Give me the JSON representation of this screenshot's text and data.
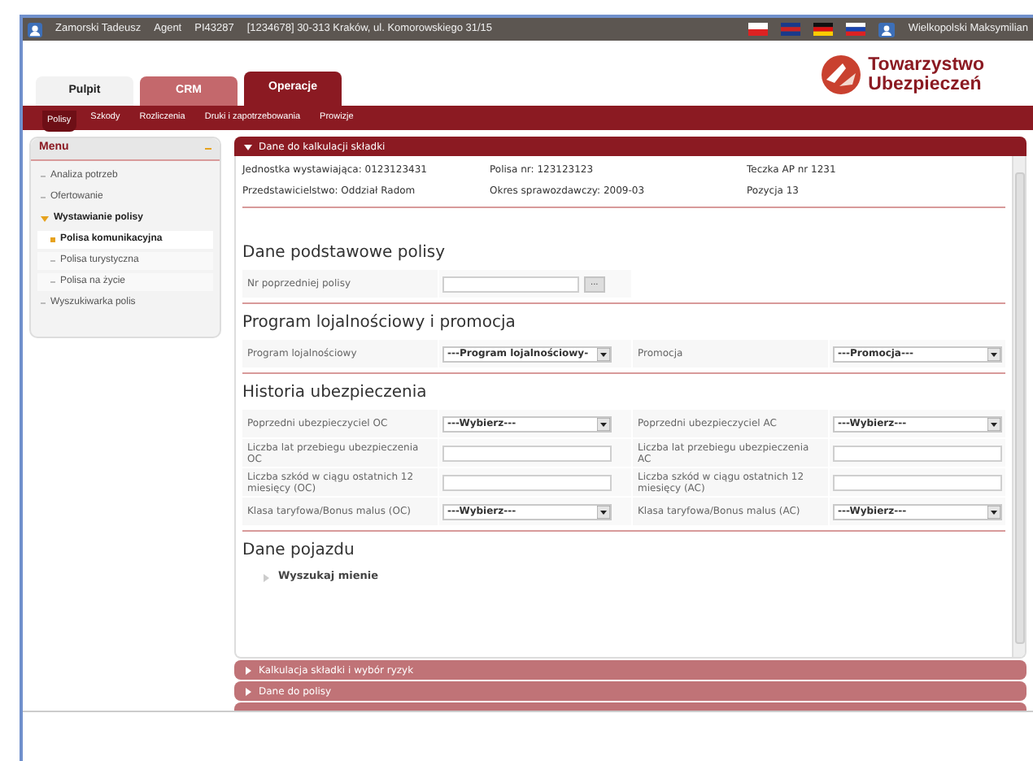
{
  "top_bar": {
    "user": "Zamorski Tadeusz",
    "role": "Agent",
    "agent_id": "PI43287",
    "address": "[1234678] 30-313 Kraków, ul. Komorowskiego 31/15",
    "right_user": "Wielkopolski Maksymilian"
  },
  "logo": {
    "line1": "Towarzystwo",
    "line2": "Ubezpieczeń"
  },
  "tabs": [
    {
      "label": "Pulpit",
      "selected": false,
      "color": "#f2f2f2"
    },
    {
      "label": "CRM",
      "selected": false,
      "color": "#c4686c"
    },
    {
      "label": "Operacje",
      "selected": true,
      "color": "#8b1a22"
    }
  ],
  "subnav": [
    {
      "label": "Polisy",
      "selected": true
    },
    {
      "label": "Szkody",
      "selected": false
    },
    {
      "label": "Rozliczenia",
      "selected": false
    },
    {
      "label": "Druki i zapotrzebowania",
      "selected": false
    },
    {
      "label": "Prowizje",
      "selected": false
    }
  ],
  "menu": {
    "title": "Menu",
    "items": [
      {
        "label": "Analiza potrzeb",
        "expanded": false,
        "selected": false
      },
      {
        "label": "Ofertowanie",
        "expanded": false,
        "selected": false
      },
      {
        "label": "Wystawianie polisy",
        "expanded": true,
        "selected": false,
        "children": [
          {
            "label": "Polisa komunikacyjna",
            "selected": true
          },
          {
            "label": "Polisa turystyczna",
            "selected": false
          },
          {
            "label": "Polisa na życie",
            "selected": false
          }
        ]
      },
      {
        "label": "Wyszukiwarka polis",
        "expanded": false,
        "selected": false
      }
    ]
  },
  "panel": {
    "title": "Dane do kalkulacji składki",
    "expanded": true,
    "info": [
      "Jednostka wystawiająca: 0123123431",
      "Polisa nr: 123123123",
      "Teczka AP nr 1231",
      "Przedstawicielstwo: Oddział Radom",
      "Okres sprawozdawczy: 2009-03",
      "Pozycja 13"
    ],
    "sections": [
      {
        "title": "Dane podstawowe polisy",
        "rows": [
          {
            "cells": [
              {
                "label": "Nr poprzedniej polisy",
                "kind": "lookup",
                "button": "..."
              }
            ]
          }
        ]
      },
      {
        "title": "Program lojalnościowy i promocja",
        "rows": [
          {
            "cells": [
              {
                "label": "Program lojalnościowy",
                "kind": "select",
                "value": "---Program lojalnościowy-"
              },
              {
                "label": "Promocja",
                "kind": "select",
                "value": "---Promocja---"
              }
            ]
          }
        ]
      },
      {
        "title": "Historia ubezpieczenia",
        "rows": [
          {
            "cells": [
              {
                "label": "Poprzedni ubezpieczyciel OC",
                "kind": "select",
                "value": "---Wybierz---"
              },
              {
                "label": "Poprzedni ubezpieczyciel AC",
                "kind": "select",
                "value": "---Wybierz---"
              }
            ]
          },
          {
            "cells": [
              {
                "label": "Liczba lat przebiegu ubezpieczenia OC",
                "kind": "text"
              },
              {
                "label": "Liczba lat przebiegu ubezpieczenia AC",
                "kind": "text"
              }
            ]
          },
          {
            "cells": [
              {
                "label": "Liczba szkód w ciągu ostatnich 12 miesięcy (OC)",
                "kind": "text"
              },
              {
                "label": "Liczba szkód w ciągu ostatnich 12 miesięcy (AC)",
                "kind": "text"
              }
            ]
          },
          {
            "cells": [
              {
                "label": "Klasa taryfowa/Bonus malus (OC)",
                "kind": "select",
                "value": "---Wybierz---"
              },
              {
                "label": "Klasa taryfowa/Bonus malus (AC)",
                "kind": "select",
                "value": "---Wybierz---"
              }
            ]
          }
        ]
      },
      {
        "title": "Dane pojazdu",
        "link": "Wyszukaj mienie"
      }
    ]
  },
  "collapsed_panels": [
    {
      "title": "Kalkulacja składki i wybór ryzyk",
      "expanded": false
    },
    {
      "title": "Dane do polisy",
      "expanded": false
    }
  ]
}
